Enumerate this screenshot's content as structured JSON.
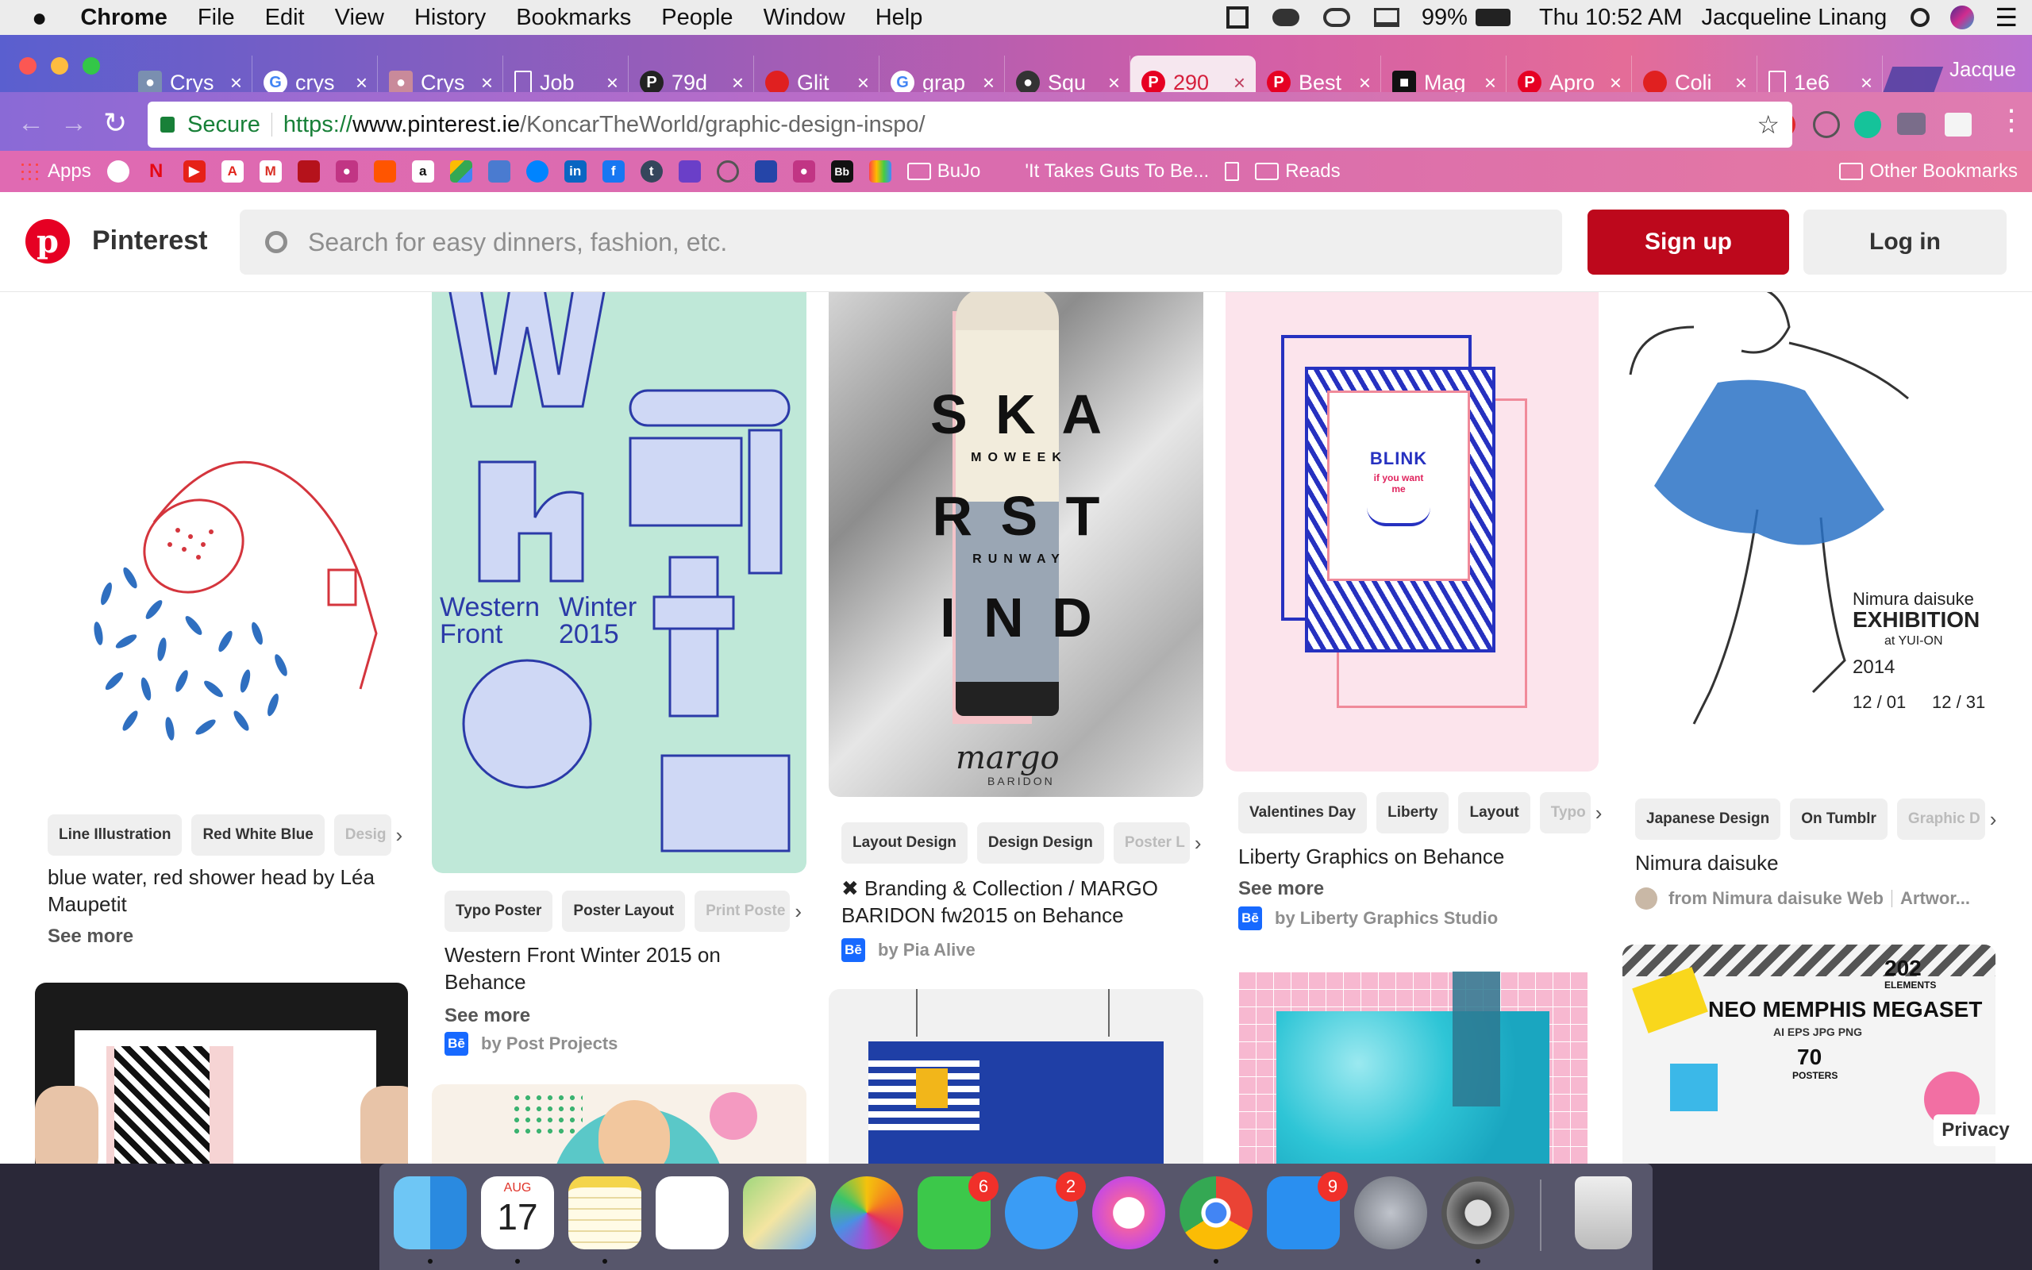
{
  "menubar": {
    "app": "Chrome",
    "items": [
      "File",
      "Edit",
      "View",
      "History",
      "Bookmarks",
      "People",
      "Window",
      "Help"
    ],
    "battery": "99%",
    "clock": "Thu 10:52 AM",
    "user": "Jacqueline Linang"
  },
  "tabs": [
    {
      "label": "Crys"
    },
    {
      "label": "crys"
    },
    {
      "label": "Crys"
    },
    {
      "label": "Job"
    },
    {
      "label": "79d"
    },
    {
      "label": "Glit"
    },
    {
      "label": "grap"
    },
    {
      "label": "Squ"
    },
    {
      "label": "290"
    },
    {
      "label": "Best"
    },
    {
      "label": "Mag"
    },
    {
      "label": "Apro"
    },
    {
      "label": "Coli"
    },
    {
      "label": "1e6"
    }
  ],
  "profile_name": "Jacque",
  "address": {
    "secure_label": "Secure",
    "url_scheme": "https://",
    "url_host": "www.pinterest.ie",
    "url_path": "/KoncarTheWorld/graphic-design-inspo/"
  },
  "bookmarks": {
    "apps": "Apps",
    "bujo": "BuJo",
    "guts": "'It Takes Guts To Be...",
    "reads": "Reads",
    "other": "Other Bookmarks"
  },
  "pinterest": {
    "brand": "Pinterest",
    "search_placeholder": "Search for easy dinners, fashion, etc.",
    "signup": "Sign up",
    "login": "Log in",
    "privacy": "Privacy"
  },
  "pins": {
    "p1": {
      "tags": [
        "Line Illustration",
        "Red White Blue",
        "Desig"
      ],
      "title_l1": "blue water, red shower head by Léa",
      "title_l2": "Maupetit",
      "see_more": "See more"
    },
    "p2": {
      "tags": [
        "Typo Poster",
        "Poster Layout",
        "Print Poste"
      ],
      "title_l1": "Western Front Winter 2015 on",
      "title_l2": "Behance",
      "see_more": "See more",
      "by": "by Post Projects",
      "art_line1": "Western",
      "art_line2": "Front",
      "art_line3": "Winter",
      "art_line4": "2015"
    },
    "p3": {
      "tags": [
        "Layout Design",
        "Design Design",
        "Poster L"
      ],
      "title_l1": "✖ Branding & Collection / MARGO",
      "title_l2": "BARIDON fw2015 on Behance",
      "by": "by Pia Alive",
      "art_row1": "S K A",
      "art_row2": "R S T",
      "art_row3": "I N D",
      "art_sub1": "MOWEEK",
      "art_sub2": "RUNWAY",
      "art_sig": "margo",
      "art_sig2": "BARIDON"
    },
    "p4": {
      "tags": [
        "Valentines Day",
        "Liberty",
        "Layout",
        "Typo"
      ],
      "title": "Liberty Graphics on Behance",
      "see_more": "See more",
      "by": "by Liberty Graphics Studio",
      "art_blink": "BLINK",
      "art_sub": "if you want me"
    },
    "p5": {
      "tags": [
        "Japanese Design",
        "On Tumblr",
        "Graphic D"
      ],
      "title": "Nimura daisuke",
      "from": "from Nimura daisuke Web",
      "from2": "Artwor...",
      "art_name": "Nimura daisuke",
      "art_exh": "EXHIBITION",
      "art_at": "at YUI-ON",
      "art_year": "2014",
      "art_d1": "12 / 01",
      "art_d2": "12 / 31"
    },
    "p9": {
      "art_title": "NEO MEMPHIS MEGASET",
      "art_fmt": "AI EPS JPG PNG",
      "art_n1": "202",
      "art_n2": "ELEMENTS",
      "art_n3": "70",
      "art_n4": "POSTERS"
    }
  },
  "dock": {
    "calendar_month": "AUG",
    "calendar_day": "17",
    "facetime_badge": "6",
    "messages_badge": "2",
    "appstore_badge": "9"
  }
}
